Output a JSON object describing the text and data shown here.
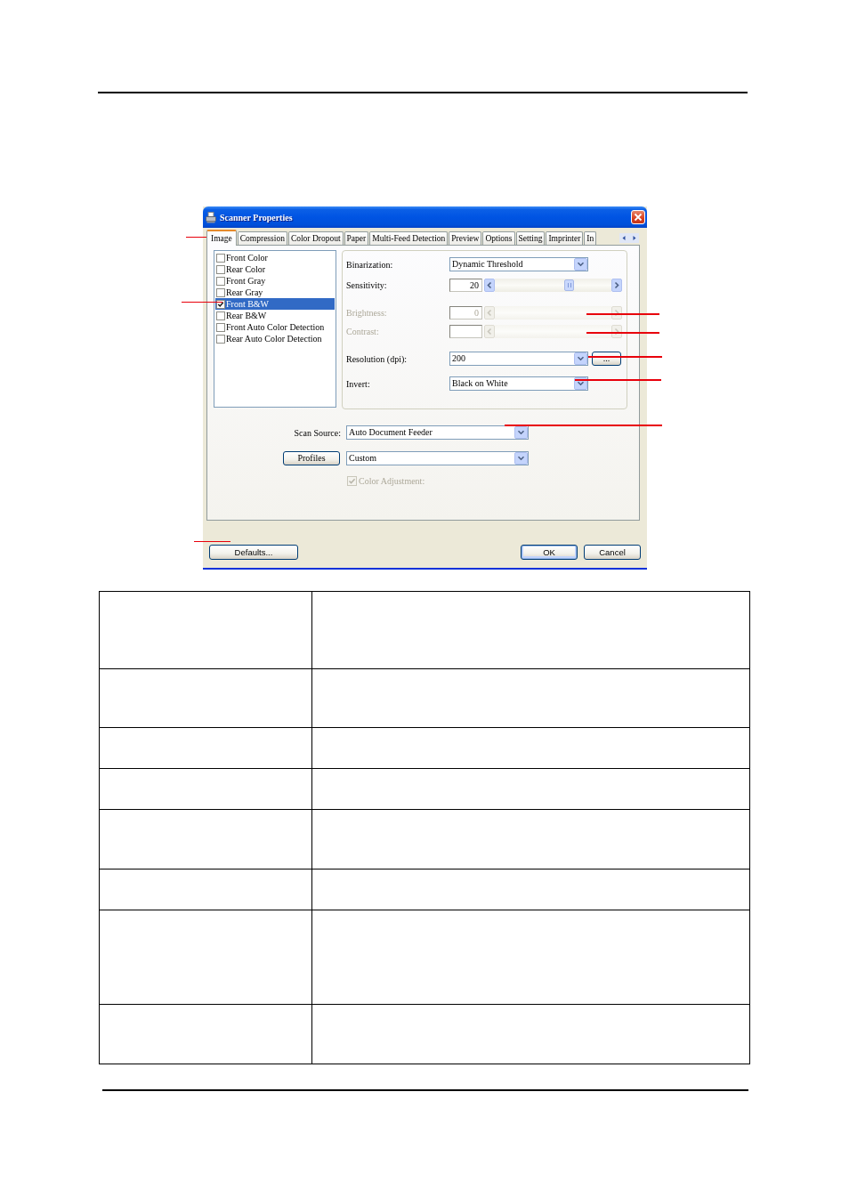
{
  "dialog": {
    "title": "Scanner Properties",
    "tabs": [
      {
        "label": "Image",
        "selected": true
      },
      {
        "label": "Compression",
        "selected": false
      },
      {
        "label": "Color Dropout",
        "selected": false
      },
      {
        "label": "Paper",
        "selected": false
      },
      {
        "label": "Multi-Feed Detection",
        "selected": false
      },
      {
        "label": "Preview",
        "selected": false
      },
      {
        "label": "Options",
        "selected": false
      },
      {
        "label": "Setting",
        "selected": false
      },
      {
        "label": "Imprinter",
        "selected": false
      },
      {
        "label": "In",
        "selected": false
      }
    ],
    "image_types": [
      {
        "label": "Front Color",
        "checked": false,
        "selected": false
      },
      {
        "label": "Rear Color",
        "checked": false,
        "selected": false
      },
      {
        "label": "Front Gray",
        "checked": false,
        "selected": false
      },
      {
        "label": "Rear Gray",
        "checked": false,
        "selected": false
      },
      {
        "label": "Front B&W",
        "checked": true,
        "selected": true
      },
      {
        "label": "Rear B&W",
        "checked": false,
        "selected": false
      },
      {
        "label": "Front Auto Color Detection",
        "checked": false,
        "selected": false
      },
      {
        "label": "Rear Auto Color Detection",
        "checked": false,
        "selected": false
      }
    ],
    "settings": [
      {
        "kind": "dropdown",
        "label": "Binarization:",
        "value": "Dynamic Threshold",
        "disabled": false
      },
      {
        "kind": "slider",
        "label": "Sensitivity:",
        "value": "20",
        "level": 0.65,
        "disabled": false
      },
      {
        "kind": "slider",
        "label": "Brightness:",
        "value": "0",
        "disabled": true
      },
      {
        "kind": "slider",
        "label": "Contrast:",
        "disabled": true
      },
      {
        "kind": "dropdown",
        "label": "Resolution (dpi):",
        "value": "200",
        "button": "...",
        "disabled": false
      },
      {
        "kind": "dropdown",
        "label": "Invert:",
        "value": "Black on White",
        "disabled": false
      }
    ],
    "scan_source": {
      "label": "Scan Source:",
      "value": "Auto Document Feeder"
    },
    "profiles": {
      "button": "Profiles",
      "value": "Custom"
    },
    "color_adjustment": {
      "label": "Color Adjustment:",
      "checked": true,
      "disabled": true
    },
    "buttons": [
      {
        "label": "Defaults...",
        "default": false
      },
      {
        "label": "OK",
        "default": true
      },
      {
        "label": "Cancel",
        "default": false
      }
    ]
  }
}
